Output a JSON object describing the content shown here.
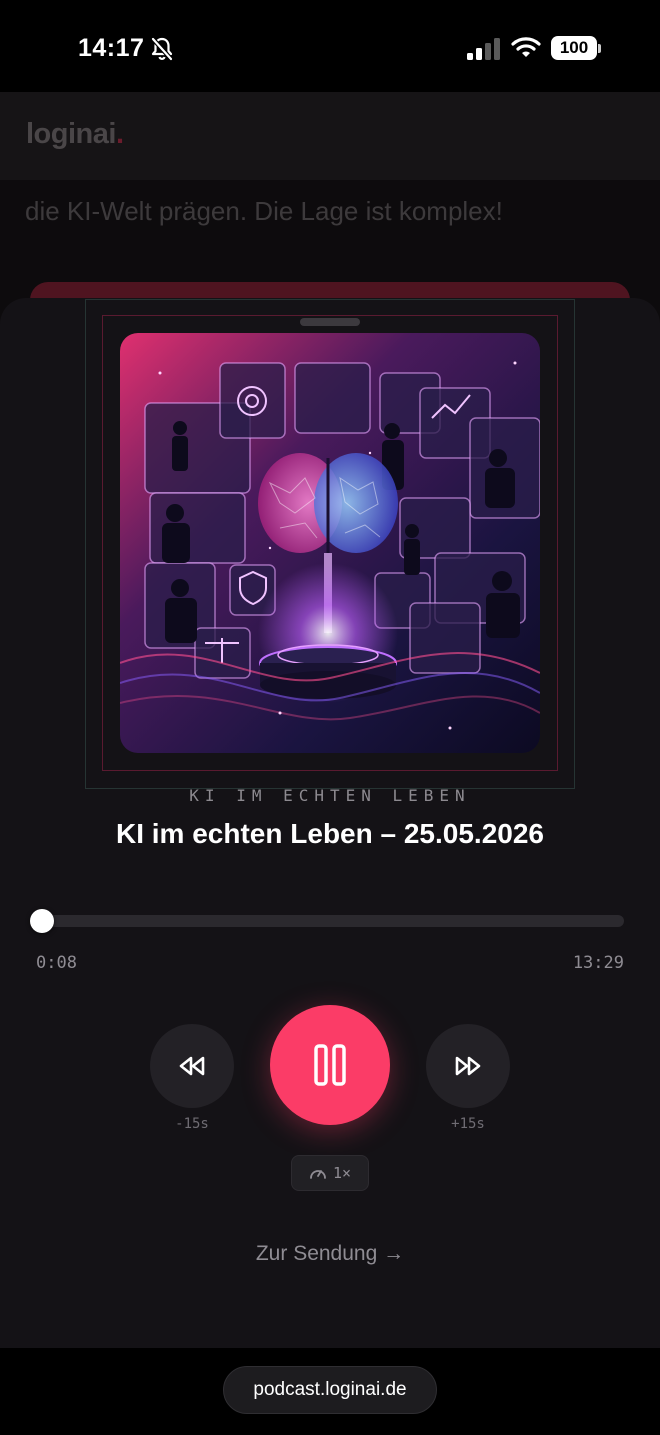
{
  "status_bar": {
    "time": "14:17",
    "battery": "100",
    "icons": [
      "bell-slash-icon",
      "signal-icon",
      "wifi-icon",
      "battery-icon"
    ]
  },
  "background_page": {
    "logo": "loginai",
    "logo_dot": ".",
    "text": "die KI-Welt prägen. Die Lage ist komplex!"
  },
  "player": {
    "show_name": "KI IM ECHTEN LEBEN",
    "episode_title": "KI im echten Leben – 25.05.2026",
    "progress": {
      "current": "0:08",
      "total": "13:29",
      "fraction": 0.0099
    },
    "controls": {
      "rewind_label": "-15s",
      "forward_label": "+15s",
      "speed_label": "1×",
      "rewind_icon": "rewind-icon",
      "play_state_icon": "pause-icon",
      "forward_icon": "fast-forward-icon",
      "speed_icon": "gauge-icon"
    },
    "show_link": "Zur Sendung →"
  },
  "browser": {
    "url": "podcast.loginai.de"
  },
  "colors": {
    "accent": "#fb3c67",
    "sheet_bg": "#141216",
    "page_bg": "#0d0b0d"
  }
}
